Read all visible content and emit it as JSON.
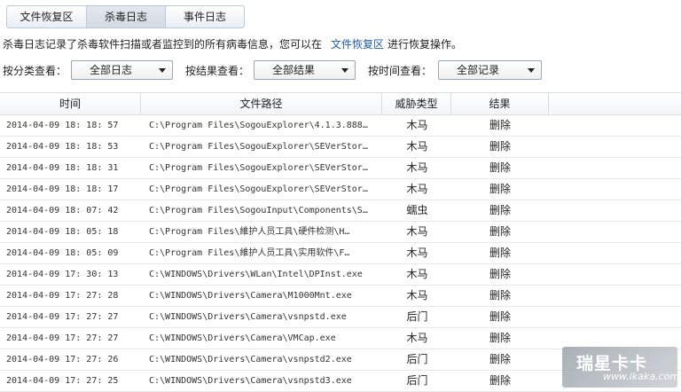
{
  "tabs": [
    {
      "label": "文件恢复区",
      "active": false
    },
    {
      "label": "杀毒日志",
      "active": true
    },
    {
      "label": "事件日志",
      "active": false
    }
  ],
  "info": {
    "text": "杀毒日志记录了杀毒软件扫描或者监控到的所有病毒信息，您可以在",
    "link": "文件恢复区",
    "suffix": "进行恢复操作。"
  },
  "filters": {
    "category": {
      "label": "按分类查看：",
      "value": "全部日志"
    },
    "result": {
      "label": "按结果查看：",
      "value": "全部结果"
    },
    "time": {
      "label": "按时间查看：",
      "value": "全部记录"
    }
  },
  "table": {
    "headers": {
      "time": "时间",
      "path": "文件路径",
      "type": "威胁类型",
      "result": "结果"
    },
    "rows": [
      {
        "time": "2014-04-09 18: 18: 57",
        "path": "C:\\Program  Files\\SogouExplorer\\4.1.3.888…",
        "type": "木马",
        "result": "删除"
      },
      {
        "time": "2014-04-09 18: 18: 53",
        "path": "C:\\Program Files\\SogouExplorer\\SEVerStor…",
        "type": "木马",
        "result": "删除"
      },
      {
        "time": "2014-04-09 18: 18: 31",
        "path": "C:\\Program Files\\SogouExplorer\\SEVerStor…",
        "type": "木马",
        "result": "删除"
      },
      {
        "time": "2014-04-09 18: 18: 17",
        "path": "C:\\Program Files\\SogouExplorer\\SEVerStor…",
        "type": "木马",
        "result": "删除"
      },
      {
        "time": "2014-04-09 18: 07: 42",
        "path": "C:\\Program Files\\SogouInput\\Components\\S…",
        "type": "蠕虫",
        "result": "删除"
      },
      {
        "time": "2014-04-09 18: 05: 18",
        "path": "C:\\Program  Files\\維护人员工具\\硬件检测\\H…",
        "type": "木马",
        "result": "删除"
      },
      {
        "time": "2014-04-09 18: 05: 09",
        "path": "C:\\Program  Files\\維护人员工具\\实用软件\\F…",
        "type": "木马",
        "result": "删除"
      },
      {
        "time": "2014-04-09 17: 30: 13",
        "path": "C:\\WINDOWS\\Drivers\\WLan\\Intel\\DPInst.exe",
        "type": "木马",
        "result": "删除"
      },
      {
        "time": "2014-04-09 17: 27: 28",
        "path": "C:\\WINDOWS\\Drivers\\Camera\\M1000Mnt.exe",
        "type": "木马",
        "result": "删除"
      },
      {
        "time": "2014-04-09 17: 27: 27",
        "path": "C:\\WINDOWS\\Drivers\\Camera\\vsnpstd.exe",
        "type": "后门",
        "result": "删除"
      },
      {
        "time": "2014-04-09 17: 27: 27",
        "path": "C:\\WINDOWS\\Drivers\\Camera\\VMCap.exe",
        "type": "木马",
        "result": "删除"
      },
      {
        "time": "2014-04-09 17: 27: 26",
        "path": "C:\\WINDOWS\\Drivers\\Camera\\vsnpstd2.exe",
        "type": "后门",
        "result": "删除"
      },
      {
        "time": "2014-04-09 17: 27: 25",
        "path": "C:\\WINDOWS\\Drivers\\Camera\\vsnpstd3.exe",
        "type": "后门",
        "result": "删除"
      }
    ]
  },
  "watermark": {
    "main": "瑞星卡卡",
    "url": "www.ikaka.com"
  }
}
